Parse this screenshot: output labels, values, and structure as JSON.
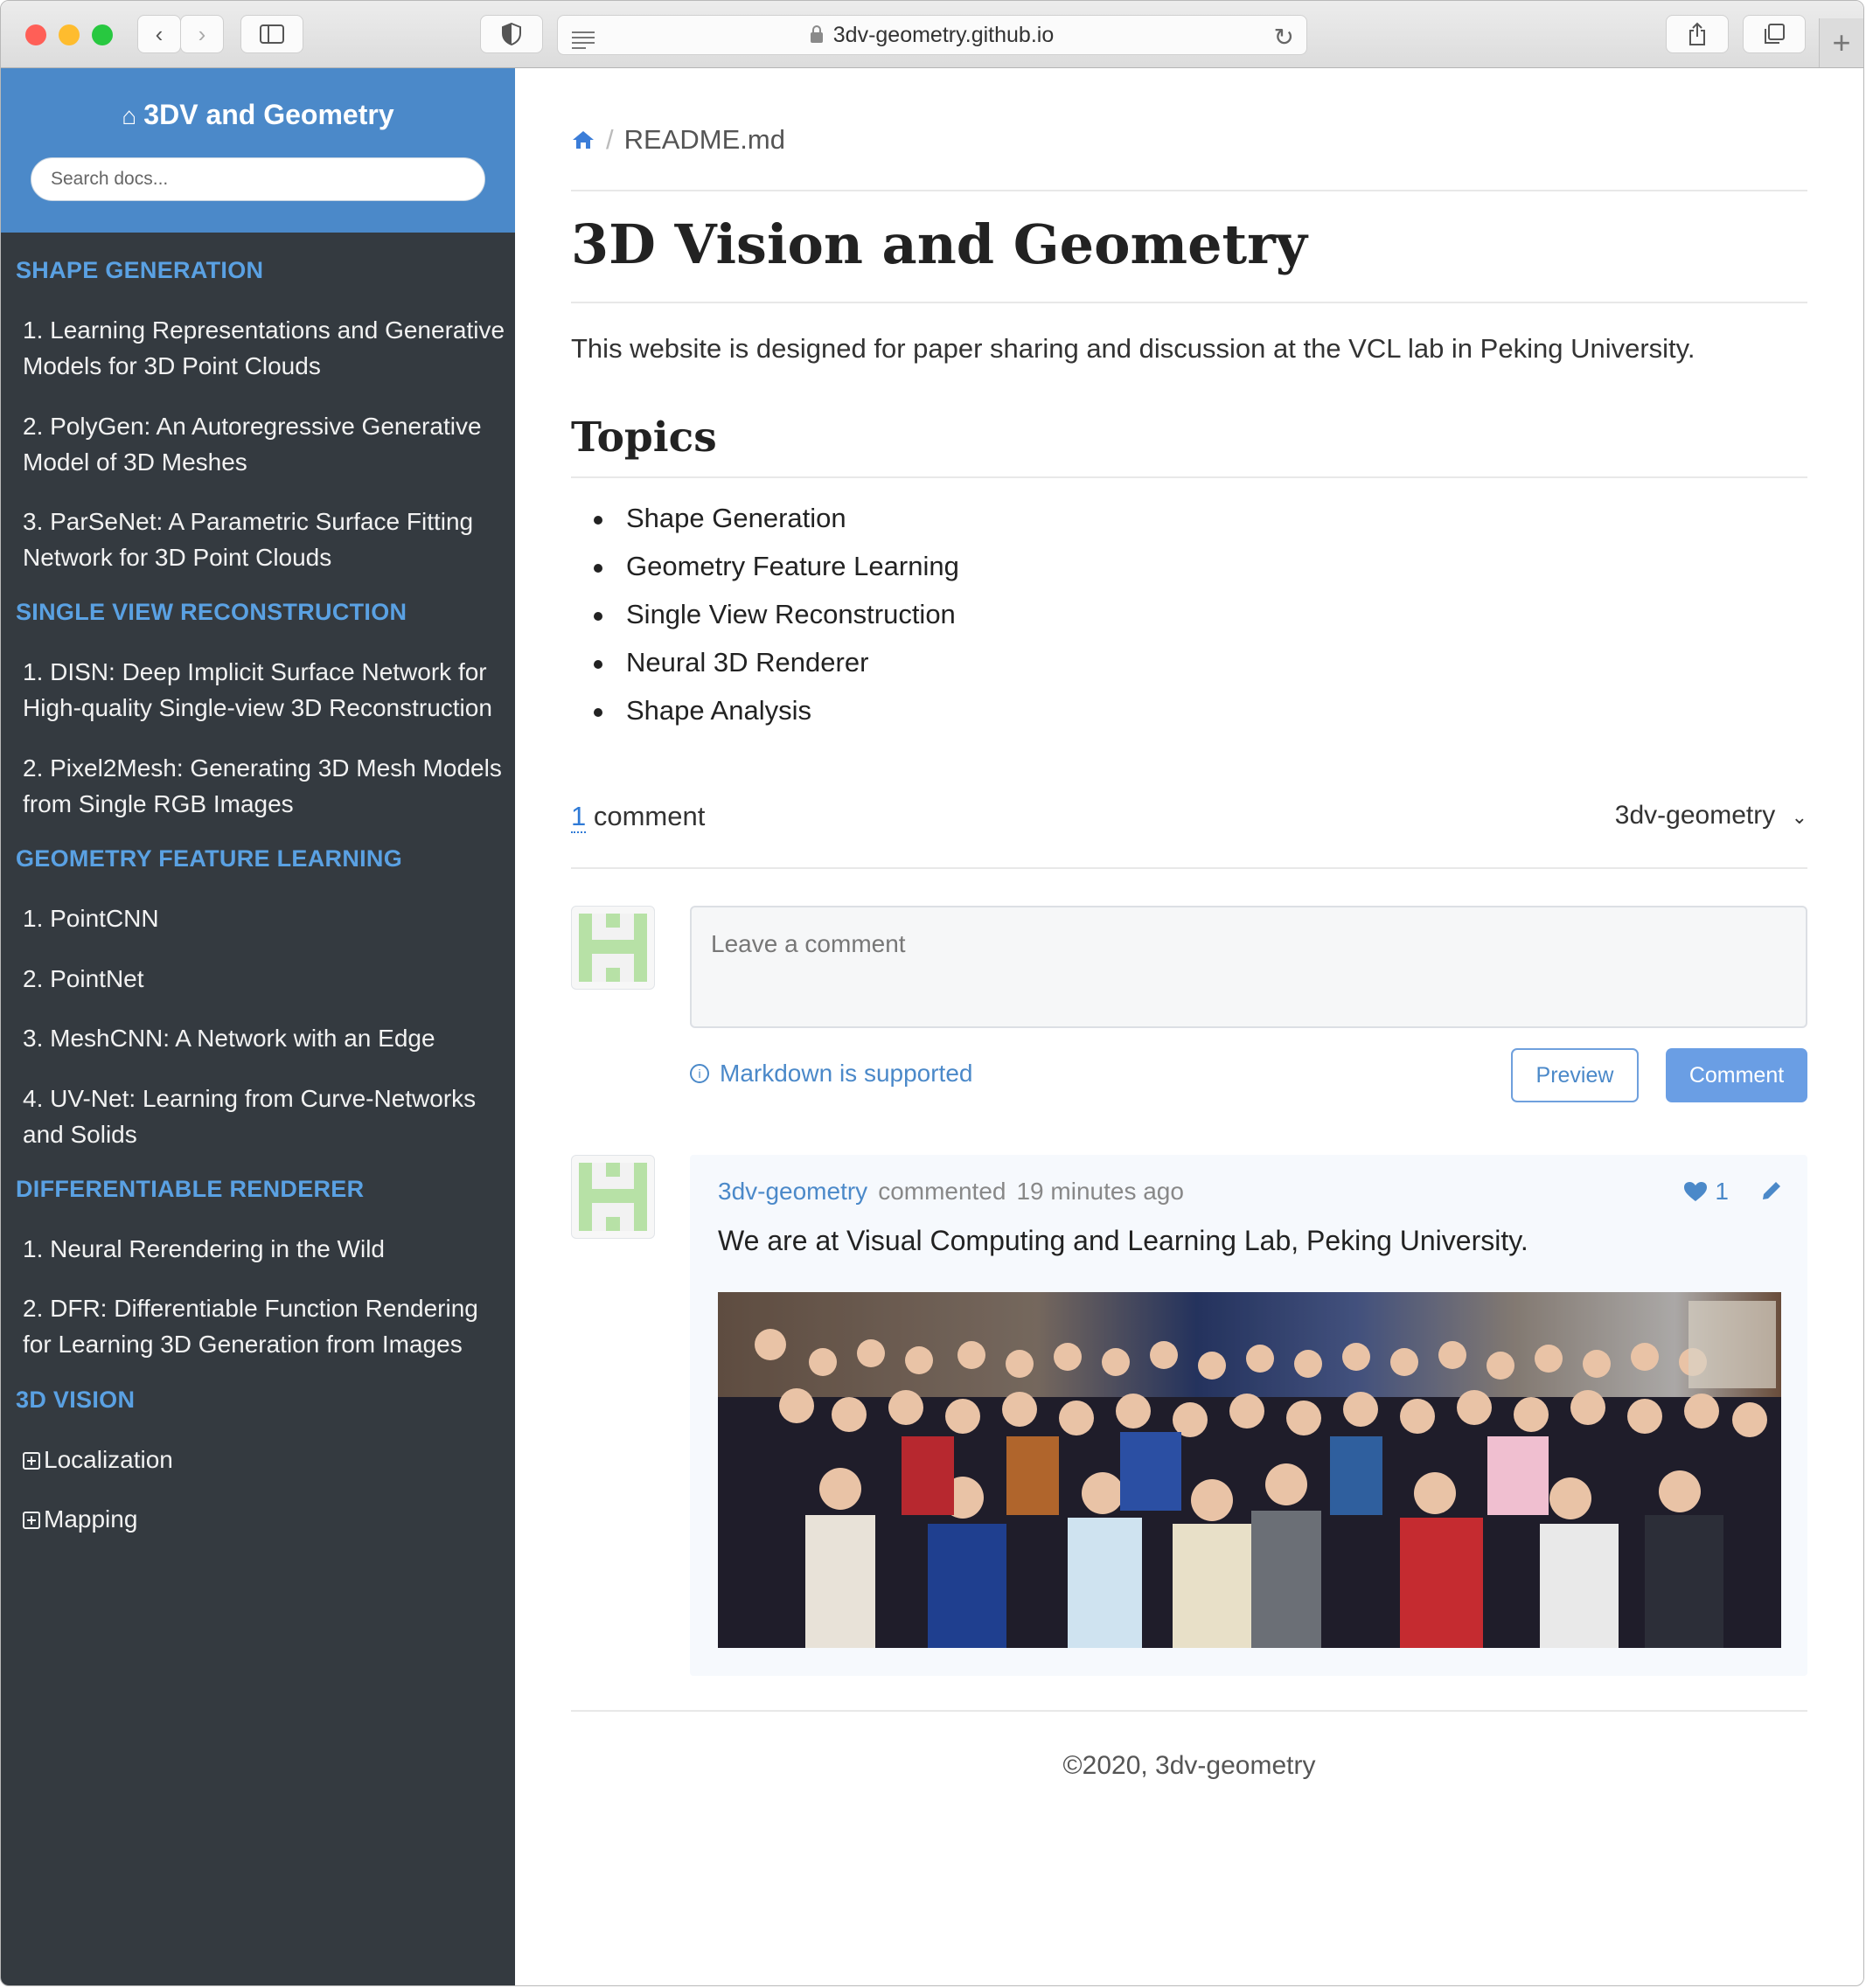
{
  "browser": {
    "url": "3dv-geometry.github.io",
    "traffic_lights": [
      "#ff5f57",
      "#febc2e",
      "#28c840"
    ]
  },
  "sidebar": {
    "title": "3DV and Geometry",
    "search_placeholder": "Search docs...",
    "sections": [
      {
        "title": "SHAPE GENERATION",
        "items": [
          "1. Learning Representations and Generative Models for 3D Point Clouds",
          "2. PolyGen: An Autoregressive Generative Model of 3D Meshes",
          "3. ParSeNet: A Parametric Surface Fitting Network for 3D Point Clouds"
        ]
      },
      {
        "title": "SINGLE VIEW RECONSTRUCTION",
        "items": [
          "1. DISN: Deep Implicit Surface Network for High-quality Single-view 3D Reconstruction",
          "2. Pixel2Mesh: Generating 3D Mesh Models from Single RGB Images"
        ]
      },
      {
        "title": "GEOMETRY FEATURE LEARNING",
        "items": [
          "1. PointCNN",
          "2. PointNet",
          "3. MeshCNN: A Network with an Edge",
          "4. UV-Net: Learning from Curve-Networks and Solids"
        ]
      },
      {
        "title": "DIFFERENTIABLE RENDERER",
        "items": [
          "1. Neural Rerendering in the Wild",
          "2. DFR: Differentiable Function Rendering for Learning 3D Generation from Images"
        ]
      },
      {
        "title": "3D VISION",
        "items": [
          "Localization",
          "Mapping"
        ]
      }
    ]
  },
  "main": {
    "breadcrumb": "README.md",
    "title": "3D Vision and Geometry",
    "intro": "This website is designed for paper sharing and discussion at the VCL lab in Peking University.",
    "topics_heading": "Topics",
    "topics": [
      "Shape Generation",
      "Geometry Feature Learning",
      "Single View Reconstruction",
      "Neural 3D Renderer",
      "Shape Analysis"
    ]
  },
  "comments": {
    "count": "1",
    "count_label": " comment",
    "user": "3dv-geometry",
    "input_placeholder": "Leave a comment",
    "markdown_note": "Markdown is supported",
    "preview_label": "Preview",
    "comment_label": "Comment",
    "item": {
      "author": "3dv-geometry",
      "verb": "commented",
      "time": "19 minutes ago",
      "likes": "1",
      "text": "We are at Visual Computing and Learning Lab, Peking University."
    }
  },
  "footer": "©2020, 3dv-geometry",
  "colors": {
    "accent": "#4b89c9",
    "sidebar_bg": "#343a40",
    "section": "#5aa1e3"
  }
}
